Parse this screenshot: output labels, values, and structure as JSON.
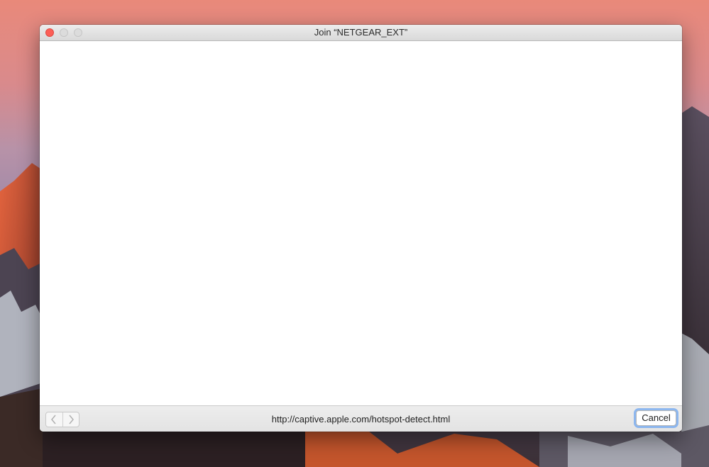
{
  "window": {
    "title": "Join “NETGEAR_EXT”"
  },
  "toolbar": {
    "back_icon": "chevron-left-icon",
    "forward_icon": "chevron-right-icon",
    "url": "http://captive.apple.com/hotspot-detect.html",
    "cancel_label": "Cancel"
  },
  "colors": {
    "close_button": "#fc5f57",
    "focus_ring": "#6ea5f0"
  }
}
